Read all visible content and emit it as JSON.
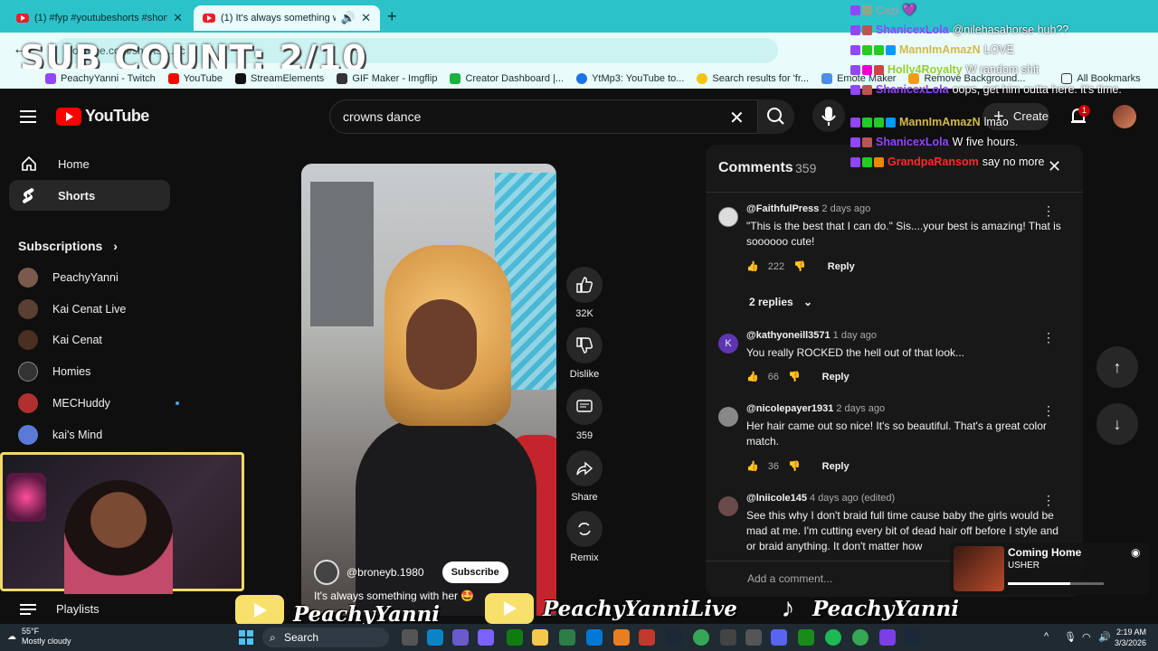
{
  "browser": {
    "tabs": [
      {
        "title": "(1) #fyp #youtubeshorts #shon",
        "active": false
      },
      {
        "title": "(1) It's always something wi",
        "active": true
      }
    ],
    "address": "youtube.com/shorts/...gc",
    "bookmarks": [
      "PeachyYanni - Twitch",
      "YouTube",
      "StreamElements",
      "GIF Maker - Imgflip",
      "Creator Dashboard |...",
      "YtMp3: YouTube to...",
      "Search results for 'fr...",
      "Emote Maker",
      "Remove Background...",
      "All Bookmarks"
    ]
  },
  "overlay": {
    "sub_count": "SUB COUNT: 2/10"
  },
  "youtube": {
    "logo": "YouTube",
    "search_query": "crowns dance",
    "create_label": "Create",
    "notif_count": "1",
    "nav": [
      {
        "label": "Home",
        "icon": "home-icon"
      },
      {
        "label": "Shorts",
        "icon": "shorts-icon"
      }
    ],
    "subscriptions_title": "Subscriptions",
    "subscriptions": [
      "PeachyYanni",
      "Kai Cenat Live",
      "Kai Cenat",
      "Homies",
      "MECHuddy",
      "kai's Mind"
    ],
    "playlists_label": "Playlists"
  },
  "short": {
    "channel": "@broneyb.1980",
    "subscribe": "Subscribe",
    "caption": "It's always something with her 🤩",
    "likes": "32K",
    "dislike": "Dislike",
    "comments": "359",
    "share": "Share",
    "remix": "Remix"
  },
  "comments_panel": {
    "title": "Comments",
    "count": "359",
    "replies_toggle": "2 replies",
    "add_placeholder": "Add a comment...",
    "reply_label": "Reply",
    "items": [
      {
        "handle": "@FaithfulPress",
        "ago": "2 days ago",
        "text": "\"This is the best that I can do.\" Sis....your best is amazing! That is soooooo cute!",
        "likes": "222"
      },
      {
        "handle": "@kathyoneill3571",
        "ago": "1 day ago",
        "text": "You really ROCKED the hell out of that look...",
        "likes": "66",
        "initial": "K"
      },
      {
        "handle": "@nicolepayer1931",
        "ago": "2 days ago",
        "text": "Her hair came out so nice! It's so beautiful. That's a great color match.",
        "likes": "36"
      },
      {
        "handle": "@lniicole145",
        "ago": "4 days ago (edited)",
        "text": "See this why I don't braid full time cause baby the girls would be mad at me. I'm cutting every bit of dead hair off before I style and or braid anything. It don't matter how",
        "likes": ""
      }
    ]
  },
  "chat": [
    {
      "name": "Cezi",
      "msg": "💜",
      "color": "#9aa0a6"
    },
    {
      "name": "ShanicexLola",
      "msg": "@nilehasahorse huh??",
      "color": "#9146ff"
    },
    {
      "name": "MannImAmazN",
      "msg": "LOVE",
      "color": "#d4b94a"
    },
    {
      "name": "Holly4Royalty",
      "msg": "W random shit",
      "color": "#9acd32"
    },
    {
      "name": "ShanicexLola",
      "msg": "oops, get him outta here. it's time.",
      "color": "#9146ff"
    },
    {
      "name": "MannImAmazN",
      "msg": "lmao",
      "color": "#d4b94a"
    },
    {
      "name": "ShanicexLola",
      "msg": "W five hours.",
      "color": "#9146ff"
    },
    {
      "name": "GrandpaRansom",
      "msg": "say no more",
      "color": "#ff2a2a"
    }
  ],
  "now_playing": {
    "title": "Coming Home",
    "artist": "USHER",
    "progress": 0.65
  },
  "banner": {
    "youtube_name": "PeachyYanni",
    "youtube_live_name": "PeachyYanniLive",
    "tiktok_name": "PeachyYanni"
  },
  "taskbar": {
    "weather_temp": "55°F",
    "weather_desc": "Mostly cloudy",
    "search": "Search",
    "time": "2:19 AM",
    "date": "3/3/2026"
  },
  "colors": {
    "brand_red": "#ff0000",
    "tab_bar": "#2bc3c9",
    "panel_bg": "#181818"
  }
}
